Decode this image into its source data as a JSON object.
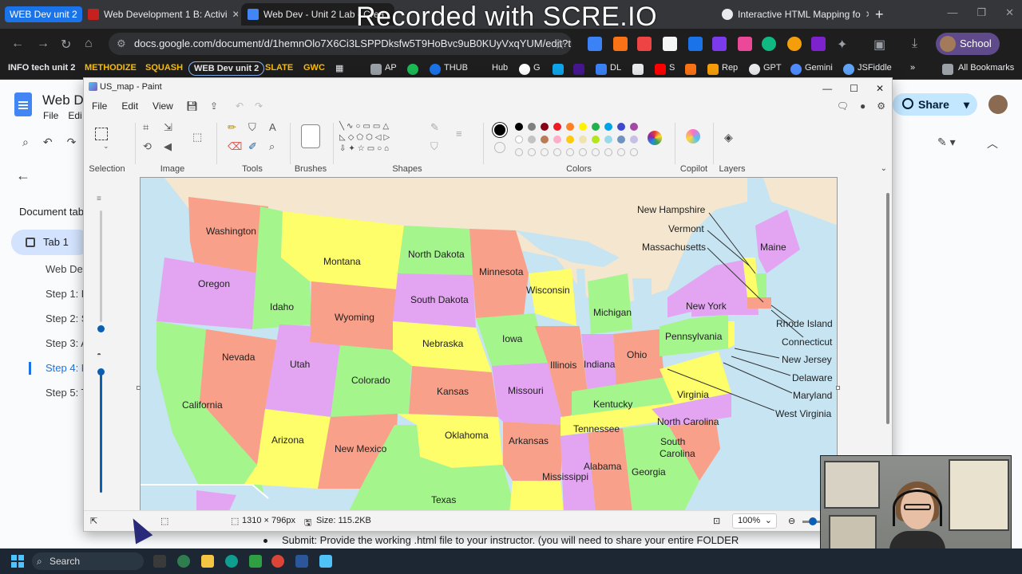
{
  "browser": {
    "profile_chip": "WEB Dev unit 2",
    "tabs": [
      {
        "title": "Web Development 1 B: Activi",
        "color": "#c5221f"
      },
      {
        "title": "Web Dev - Unit 2 Lab - Crea",
        "color": "#4285f4"
      },
      {
        "title": "Interactive HTML Mapping fo",
        "color": "#e8eaed"
      }
    ],
    "watermark": "Recorded with SCRE.IO",
    "address": "docs.google.com/document/d/1hemnOlo7X6Ci3LSPPDksfw5T9HoBvc9uB0KUyVxqYUM/edit?t...",
    "profile_label": "School",
    "bookmarks": {
      "b1": "INFO tech unit 2",
      "b2": "METHODIZE",
      "b3": "SQUASH",
      "b4": "WEB Dev unit 2",
      "b5": "SLATE",
      "b6": "GWC",
      "b7": "AP",
      "b8": "THUB",
      "b9": "Hub",
      "b10": "G",
      "b11": "DL",
      "b12": "S",
      "b13": "Rep",
      "b14": "GPT",
      "b15": "Gemini",
      "b16": "JSFiddle",
      "b17": "All Bookmarks"
    }
  },
  "docs": {
    "title": "Web Dev",
    "menu_file": "File",
    "menu_edit": "Edi",
    "document_tabs_label": "Document tab",
    "tab1": "Tab 1",
    "outline": [
      "Web Dev",
      "Step 1: P",
      "Step 2: S",
      "Step 3: A",
      "Step 4: D",
      "Step 5: T"
    ],
    "share": "Share",
    "bullet_text": "Submit: Provide the working .html file to your instructor. (you will need to share your entire FOLDER"
  },
  "paint": {
    "window_title": "US_map - Paint",
    "menu": {
      "file": "File",
      "edit": "Edit",
      "view": "View"
    },
    "groups": {
      "selection": "Selection",
      "image": "Image",
      "tools": "Tools",
      "brushes": "Brushes",
      "shapes": "Shapes",
      "colors": "Colors",
      "copilot": "Copilot",
      "layers": "Layers"
    },
    "palette": {
      "row1": [
        "#000000",
        "#7f7f7f",
        "#880015",
        "#ed1c24",
        "#ff7f27",
        "#fff200",
        "#22b14c",
        "#00a2e8",
        "#3f48cc",
        "#a349a4"
      ],
      "row2": [
        "#ffffff",
        "#c3c3c3",
        "#b97a57",
        "#ffaec9",
        "#ffc90e",
        "#efe4b0",
        "#b5e61d",
        "#99d9ea",
        "#7092be",
        "#c8bfe7"
      ]
    },
    "status": {
      "canvas_size": "1310 × 796px",
      "file_size": "Size: 115.2KB",
      "zoom": "100%"
    },
    "map": {
      "labels": {
        "washington": "Washington",
        "oregon": "Oregon",
        "california": "California",
        "nevada": "Nevada",
        "idaho": "Idaho",
        "montana": "Montana",
        "wyoming": "Wyoming",
        "utah": "Utah",
        "arizona": "Arizona",
        "colorado": "Colorado",
        "new_mexico": "New Mexico",
        "north_dakota": "North Dakota",
        "south_dakota": "South Dakota",
        "nebraska": "Nebraska",
        "kansas": "Kansas",
        "oklahoma": "Oklahoma",
        "texas": "Texas",
        "minnesota": "Minnesota",
        "iowa": "Iowa",
        "missouri": "Missouri",
        "arkansas": "Arkansas",
        "mississippi": "Mississippi",
        "wisconsin": "Wisconsin",
        "illinois": "Illinois",
        "michigan": "Michigan",
        "indiana": "Indiana",
        "ohio": "Ohio",
        "kentucky": "Kentucky",
        "tennessee": "Tennessee",
        "alabama": "Alabama",
        "georgia": "Georgia",
        "south_carolina_1": "South",
        "south_carolina_2": "Carolina",
        "north_carolina": "North Carolina",
        "virginia": "Virginia",
        "pennsylvania": "Pennsylvania",
        "new_york": "New York",
        "maine": "Maine",
        "new_hampshire": "New Hampshire",
        "vermont": "Vermont",
        "massachusetts": "Massachusetts",
        "rhode_island": "Rhode Island",
        "connecticut": "Connecticut",
        "new_jersey": "New Jersey",
        "delaware": "Delaware",
        "maryland": "Maryland",
        "west_virginia": "West Virginia"
      },
      "colors": {
        "pink": "#f9a08a",
        "purple": "#e3a4f2",
        "yellow": "#fefd6a",
        "green": "#a3f58c",
        "water": "#c6e4f2",
        "canada": "#f4e6cf"
      }
    }
  },
  "taskbar": {
    "search": "Search"
  }
}
